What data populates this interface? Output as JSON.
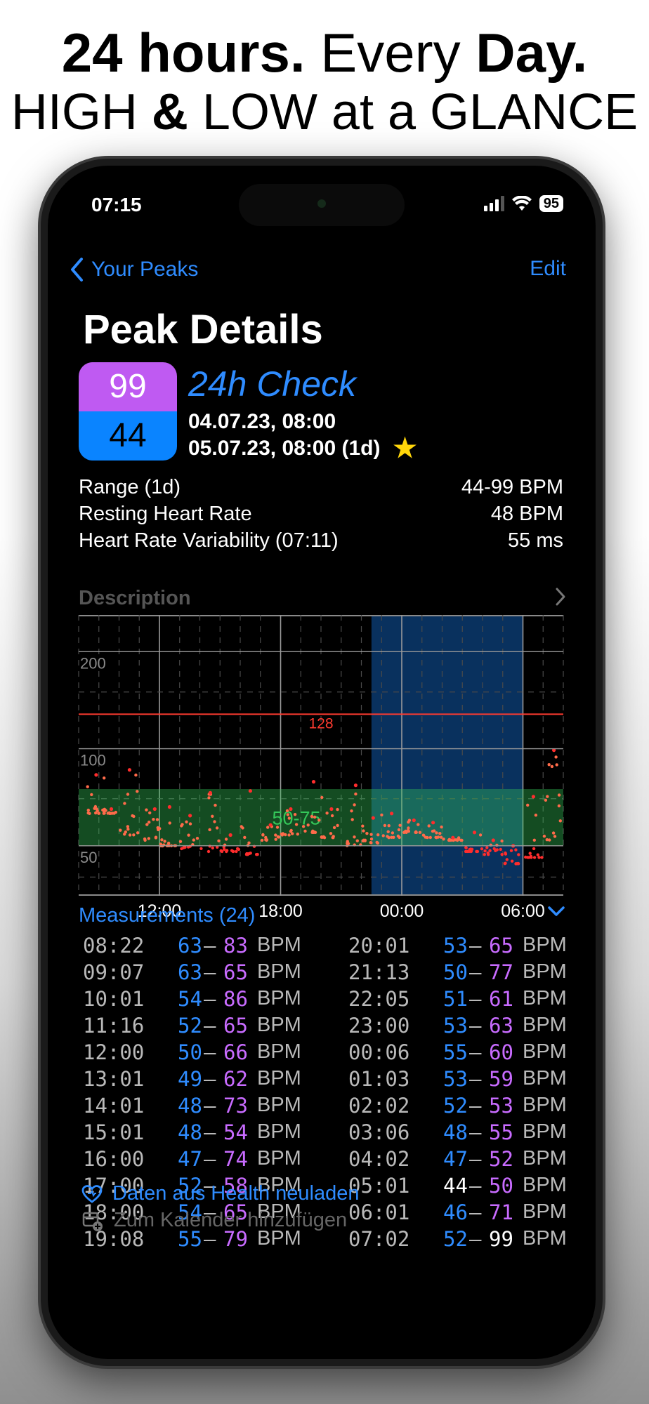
{
  "headline": {
    "line1_bold": "24 hours.",
    "line1_normal": " Every ",
    "line1_bold2": "Day.",
    "line2_normal": "HIGH ",
    "line2_bold": "&",
    "line2_normal2": " LOW at a GLANCE"
  },
  "status_bar": {
    "time": "07:15",
    "battery": "95"
  },
  "nav": {
    "back_label": "Your Peaks",
    "edit_label": "Edit"
  },
  "page": {
    "title": "Peak Details"
  },
  "peak": {
    "high": "99",
    "low": "44",
    "name": "24h Check",
    "start": "04.07.23, 08:00",
    "end": "05.07.23, 08:00 (1d)",
    "favorite_icon": "star-icon"
  },
  "stats": [
    {
      "label": "Range (1d)",
      "value": "44-99 BPM"
    },
    {
      "label": "Resting Heart Rate",
      "value": "48 BPM"
    },
    {
      "label": "Heart Rate Variability (07:11)",
      "value": "55 ms"
    }
  ],
  "description": {
    "label": "Description"
  },
  "chart_data": {
    "type": "scatter",
    "x_ticks": [
      "12:00",
      "18:00",
      "00:00",
      "06:00"
    ],
    "y_scale": "log",
    "y_ticks": [
      50,
      100,
      200
    ],
    "threshold_line": {
      "value": 128,
      "label": "128",
      "color": "#ff3b30"
    },
    "target_band": {
      "range": [
        50,
        75
      ],
      "label": "50-75",
      "color": "#34c759"
    },
    "night_shade": {
      "from": "22:30",
      "to": "06:00",
      "color": "#0a3a6e"
    },
    "point_color": "#ff6b4a",
    "highlight_color": "#ff2d2d",
    "grid": true
  },
  "measurements": {
    "title": "Measurements (24)",
    "rows": [
      {
        "time": "08:22",
        "low": "63",
        "high": "83",
        "unit": "BPM"
      },
      {
        "time": "09:07",
        "low": "63",
        "high": "65",
        "unit": "BPM"
      },
      {
        "time": "10:01",
        "low": "54",
        "high": "86",
        "unit": "BPM"
      },
      {
        "time": "11:16",
        "low": "52",
        "high": "65",
        "unit": "BPM"
      },
      {
        "time": "12:00",
        "low": "50",
        "high": "66",
        "unit": "BPM"
      },
      {
        "time": "13:01",
        "low": "49",
        "high": "62",
        "unit": "BPM"
      },
      {
        "time": "14:01",
        "low": "48",
        "high": "73",
        "unit": "BPM"
      },
      {
        "time": "15:01",
        "low": "48",
        "high": "54",
        "unit": "BPM"
      },
      {
        "time": "16:00",
        "low": "47",
        "high": "74",
        "unit": "BPM"
      },
      {
        "time": "17:00",
        "low": "52",
        "high": "58",
        "unit": "BPM"
      },
      {
        "time": "18:00",
        "low": "54",
        "high": "65",
        "unit": "BPM"
      },
      {
        "time": "19:08",
        "low": "55",
        "high": "79",
        "unit": "BPM"
      },
      {
        "time": "20:01",
        "low": "53",
        "high": "65",
        "unit": "BPM"
      },
      {
        "time": "21:13",
        "low": "50",
        "high": "77",
        "unit": "BPM"
      },
      {
        "time": "22:05",
        "low": "51",
        "high": "61",
        "unit": "BPM"
      },
      {
        "time": "23:00",
        "low": "53",
        "high": "63",
        "unit": "BPM"
      },
      {
        "time": "00:06",
        "low": "55",
        "high": "60",
        "unit": "BPM"
      },
      {
        "time": "01:03",
        "low": "53",
        "high": "59",
        "unit": "BPM"
      },
      {
        "time": "02:02",
        "low": "52",
        "high": "53",
        "unit": "BPM"
      },
      {
        "time": "03:06",
        "low": "48",
        "high": "55",
        "unit": "BPM"
      },
      {
        "time": "04:02",
        "low": "47",
        "high": "52",
        "unit": "BPM"
      },
      {
        "time": "05:01",
        "low": "44",
        "high": "50",
        "unit": "BPM",
        "low_is_min": true
      },
      {
        "time": "06:01",
        "low": "46",
        "high": "71",
        "unit": "BPM"
      },
      {
        "time": "07:02",
        "low": "52",
        "high": "99",
        "unit": "BPM",
        "high_is_max": true
      }
    ]
  },
  "actions": {
    "reload": "Daten aus Health neuladen",
    "calendar": "Zum Kalender hinzufügen"
  }
}
